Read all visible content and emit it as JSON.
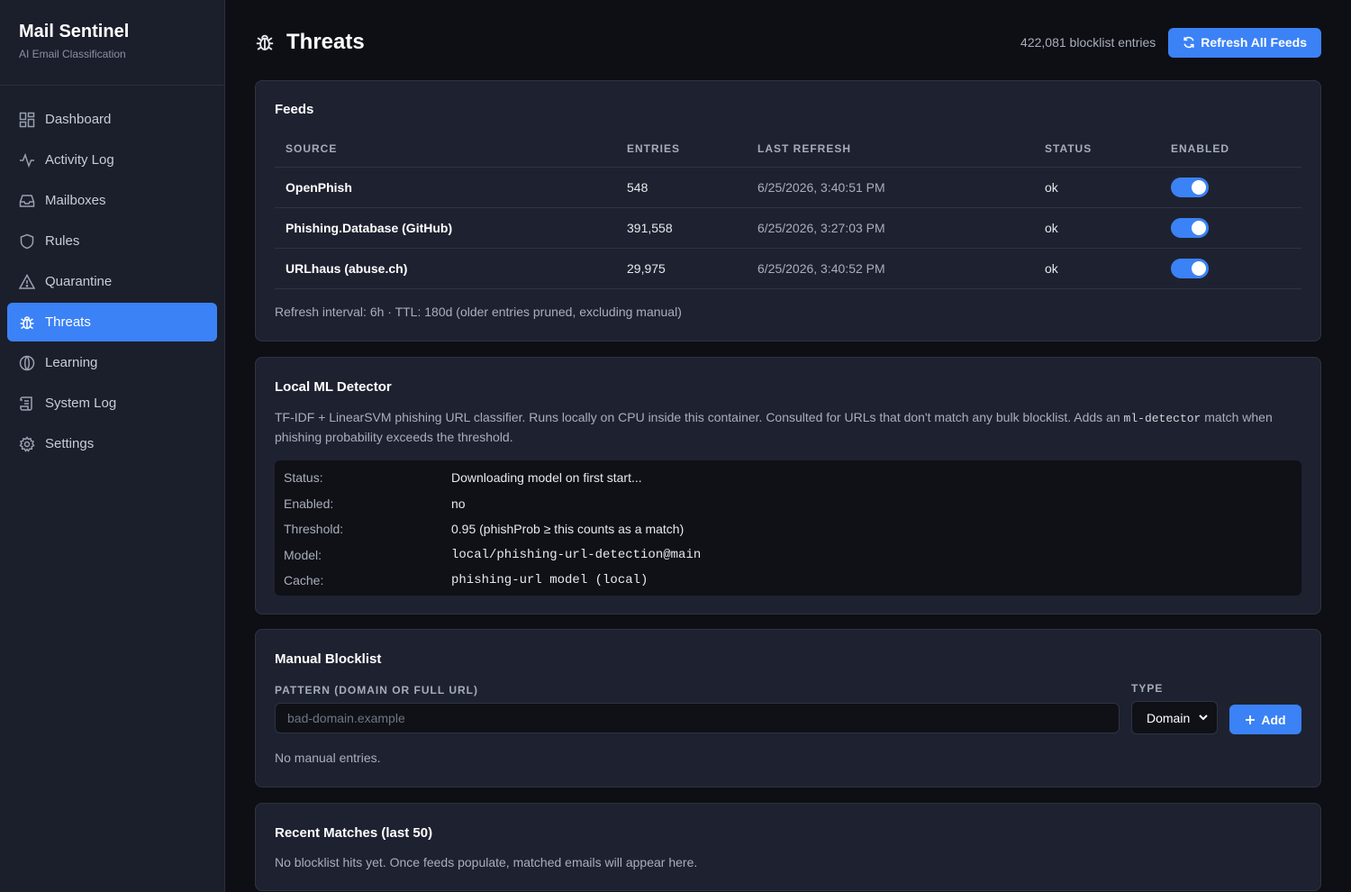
{
  "brand": {
    "title": "Mail Sentinel",
    "subtitle": "AI Email Classification"
  },
  "sidebar": {
    "items": [
      {
        "label": "Dashboard",
        "icon": "dashboard-icon"
      },
      {
        "label": "Activity Log",
        "icon": "activity-icon"
      },
      {
        "label": "Mailboxes",
        "icon": "inbox-icon"
      },
      {
        "label": "Rules",
        "icon": "shield-icon"
      },
      {
        "label": "Quarantine",
        "icon": "warning-icon"
      },
      {
        "label": "Threats",
        "icon": "bug-icon",
        "active": true
      },
      {
        "label": "Learning",
        "icon": "brain-icon"
      },
      {
        "label": "System Log",
        "icon": "scroll-icon"
      },
      {
        "label": "Settings",
        "icon": "gear-icon"
      }
    ]
  },
  "header": {
    "title": "Threats",
    "count": "422,081 blocklist entries",
    "refresh_label": "Refresh All Feeds"
  },
  "feeds": {
    "title": "Feeds",
    "columns": [
      "SOURCE",
      "ENTRIES",
      "LAST REFRESH",
      "STATUS",
      "ENABLED"
    ],
    "rows": [
      {
        "source": "OpenPhish",
        "entries": "548",
        "last_refresh": "6/25/2026, 3:40:51 PM",
        "status": "ok",
        "enabled": true
      },
      {
        "source": "Phishing.Database (GitHub)",
        "entries": "391,558",
        "last_refresh": "6/25/2026, 3:27:03 PM",
        "status": "ok",
        "enabled": true
      },
      {
        "source": "URLhaus (abuse.ch)",
        "entries": "29,975",
        "last_refresh": "6/25/2026, 3:40:52 PM",
        "status": "ok",
        "enabled": true
      }
    ],
    "note": "Refresh interval: 6h · TTL: 180d (older entries pruned, excluding manual)"
  },
  "ml": {
    "title": "Local ML Detector",
    "desc_before": "TF-IDF + LinearSVM phishing URL classifier. Runs locally on CPU inside this container. Consulted for URLs that don't match any bulk blocklist. Adds an ",
    "desc_code": "ml-detector",
    "desc_after": " match when phishing probability exceeds the threshold.",
    "status_label": "Status:",
    "status_value": "Downloading model on first start...",
    "enabled_label": "Enabled:",
    "enabled_value": "no",
    "threshold_label": "Threshold:",
    "threshold_value": "0.95 (phishProb ≥ this counts as a match)",
    "model_label": "Model:",
    "model_value": "local/phishing-url-detection@main",
    "cache_label": "Cache:",
    "cache_value": "phishing-url model (local)"
  },
  "manual": {
    "title": "Manual Blocklist",
    "pattern_label": "PATTERN (DOMAIN OR FULL URL)",
    "pattern_placeholder": "bad-domain.example",
    "type_label": "TYPE",
    "type_value": "Domain",
    "add_label": "Add",
    "empty": "No manual entries."
  },
  "recent": {
    "title": "Recent Matches (last 50)",
    "empty": "No blocklist hits yet. Once feeds populate, matched emails will appear here."
  },
  "colors": {
    "accent": "#3b82f6",
    "background": "#0d0f14",
    "sidebar": "#1b1f2b",
    "card": "#1e2230"
  }
}
